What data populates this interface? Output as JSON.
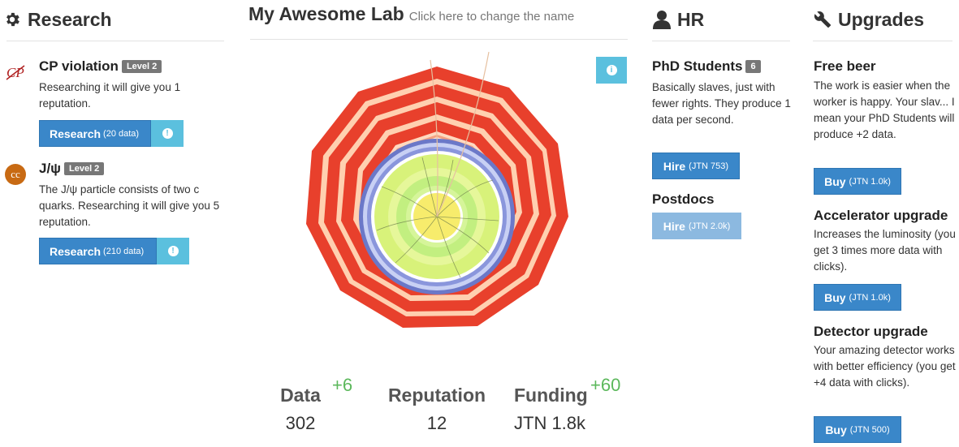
{
  "research": {
    "title": "Research",
    "items": [
      {
        "icon": "cp-violation-icon",
        "title": "CP violation",
        "level": "Level 2",
        "description": "Researching it will give you 1 reputation.",
        "button_label": "Research",
        "button_cost": "(20 data)"
      },
      {
        "icon": "charm-quark-icon",
        "icon_text": "cc",
        "title": "J/ψ",
        "level": "Level 2",
        "description": "The J/ψ particle consists of two c quarks. Researching it will give you 5 reputation.",
        "button_label": "Research",
        "button_cost": "(210 data)"
      }
    ]
  },
  "lab": {
    "name": "My Awesome Lab",
    "rename_hint": "Click here to change the name",
    "stats": {
      "data": {
        "label": "Data",
        "value": "302",
        "delta": "+6"
      },
      "reputation": {
        "label": "Reputation",
        "value": "12"
      },
      "funding": {
        "label": "Funding",
        "value": "JTN 1.8k",
        "delta": "+60"
      }
    }
  },
  "hr": {
    "title": "HR",
    "phd": {
      "title": "PhD Students",
      "count": "6",
      "description": "Basically slaves, just with fewer rights. They produce 1 data per second.",
      "button_label": "Hire",
      "button_cost": "(JTN 753)"
    },
    "postdocs": {
      "title": "Postdocs",
      "button_label": "Hire",
      "button_cost": "(JTN 2.0k)"
    }
  },
  "upgrades": {
    "title": "Upgrades",
    "items": [
      {
        "title": "Free beer",
        "description": "The work is easier when the worker is happy. Your slav... I mean your PhD Students will produce +2 data.",
        "button_label": "Buy",
        "button_cost": "(JTN 1.0k)"
      },
      {
        "title": "Accelerator upgrade",
        "description": "Increases the luminosity (you get 3 times more data with clicks).",
        "button_label": "Buy",
        "button_cost": "(JTN 1.0k)"
      },
      {
        "title": "Detector upgrade",
        "description": "Your amazing detector works with better efficiency (you get +4 data with clicks).",
        "button_label": "Buy",
        "button_cost": "(JTN 500)"
      }
    ]
  },
  "colors": {
    "button": "#3a87c9",
    "info": "#5bc0de",
    "delta": "#5cb85c",
    "detector_red": "#e8402c"
  }
}
